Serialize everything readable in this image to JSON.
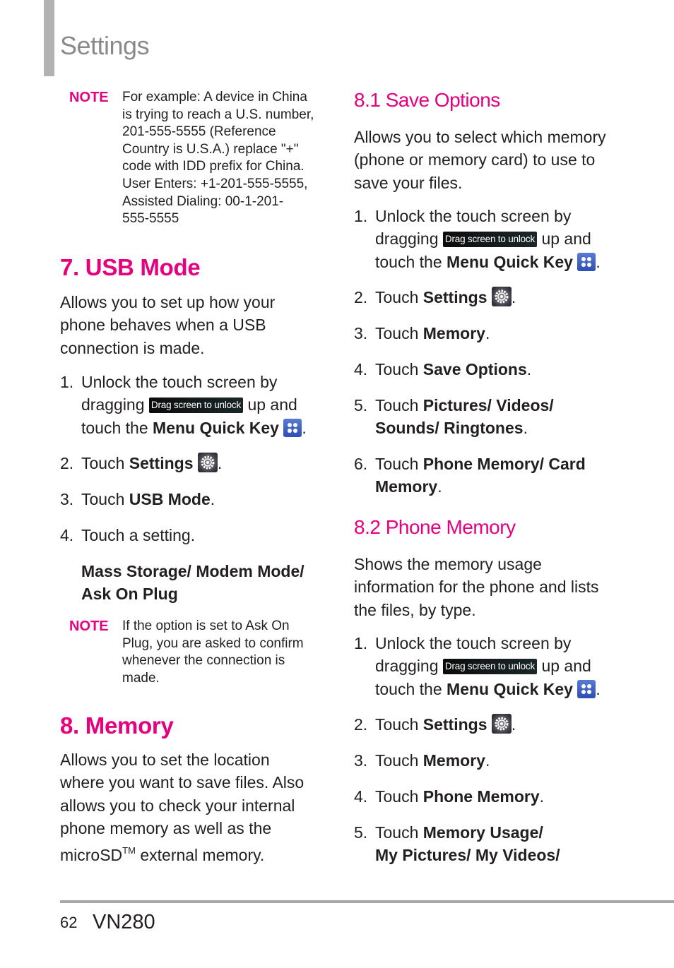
{
  "header": {
    "title": "Settings"
  },
  "left": {
    "note1": {
      "label": "NOTE",
      "lines": [
        "For example: A device in China",
        "is trying to reach a U.S. number,",
        "201-555-5555 (Reference",
        "Country is U.S.A.) replace \"+\"",
        "code with IDD prefix for China.",
        "User Enters: +1-201-555-5555,",
        "Assisted Dialing: 00-1-201-",
        "555-5555"
      ]
    },
    "usb": {
      "heading": "7. USB Mode",
      "intro": [
        "Allows you to set up how your",
        "phone behaves when a USB",
        "connection is made."
      ],
      "steps": [
        {
          "num": "1.",
          "line1": "Unlock the touch screen by",
          "pre": "dragging",
          "chip": "Drag screen to unlock",
          "post": "up and",
          "line3pre": "touch the",
          "kw": "Menu Quick Key",
          "end": "."
        },
        {
          "num": "2.",
          "pre": "Touch",
          "kw": "Settings",
          "end": "."
        },
        {
          "num": "3.",
          "pre": "Touch",
          "kw": "USB Mode",
          "end": "."
        },
        {
          "num": "4.",
          "pre": "Touch a setting.",
          "kw": "",
          "end": ""
        }
      ],
      "options": [
        "Mass Storage/ Modem Mode/",
        "Ask On Plug"
      ]
    },
    "note2": {
      "label": "NOTE",
      "lines": [
        "If the option is set to Ask On",
        "Plug, you are asked to confirm",
        "whenever the connection is",
        "made."
      ]
    },
    "memory": {
      "heading": "8. Memory",
      "intro": [
        "Allows you to set the location",
        "where you want to save files. Also",
        "allows you to check your internal",
        "phone memory as well as the"
      ],
      "intro_last_pre": "microSD",
      "intro_last_tm": "TM",
      "intro_last_post": " external memory."
    }
  },
  "right": {
    "save_options": {
      "heading": "8.1 Save Options",
      "intro": [
        "Allows you to select which memory",
        "(phone or memory card) to use to",
        "save your files."
      ],
      "steps": [
        {
          "num": "1.",
          "line1": "Unlock the touch screen by",
          "pre": "dragging",
          "chip": "Drag screen to unlock",
          "post": "up and",
          "line3pre": "touch the",
          "kw": "Menu Quick Key",
          "end": "."
        },
        {
          "num": "2.",
          "pre": "Touch",
          "kw": "Settings",
          "end": "."
        },
        {
          "num": "3.",
          "pre": "Touch",
          "kw": "Memory",
          "end": "."
        },
        {
          "num": "4.",
          "pre": "Touch",
          "kw": "Save Options",
          "end": "."
        },
        {
          "num": "5.",
          "pre": "Touch",
          "kw": "Pictures/ Videos/",
          "kw2": "Sounds/ Ringtones",
          "end": "."
        },
        {
          "num": "6.",
          "pre": "Touch",
          "kw": "Phone Memory/ Card",
          "kw2": "Memory",
          "end": "."
        }
      ]
    },
    "phone_memory": {
      "heading": "8.2 Phone Memory",
      "intro": [
        "Shows the memory usage",
        "information for the phone and lists",
        "the files, by type."
      ],
      "steps": [
        {
          "num": "1.",
          "line1": "Unlock the touch screen by",
          "pre": "dragging",
          "chip": "Drag screen to unlock",
          "post": "up and",
          "line3pre": "touch the",
          "kw": "Menu Quick Key",
          "end": "."
        },
        {
          "num": "2.",
          "pre": "Touch",
          "kw": "Settings",
          "end": "."
        },
        {
          "num": "3.",
          "pre": "Touch",
          "kw": "Memory",
          "end": "."
        },
        {
          "num": "4.",
          "pre": "Touch",
          "kw": "Phone Memory",
          "end": "."
        },
        {
          "num": "5.",
          "pre": "Touch",
          "kw": "Memory Usage/",
          "kw2": "My Pictures/ My Videos/",
          "end": ""
        }
      ]
    }
  },
  "footer": {
    "page_number": "62",
    "model": "VN280"
  },
  "icons": {
    "menu_quick_key": "menu-grid-icon",
    "settings": "gear-icon",
    "drag_unlock": "drag-unlock-bar"
  },
  "colors": {
    "accent": "#e5007e",
    "body_text": "#231f20",
    "title_gray": "#8a8a8c",
    "rule_gray": "#a7a7a8"
  }
}
